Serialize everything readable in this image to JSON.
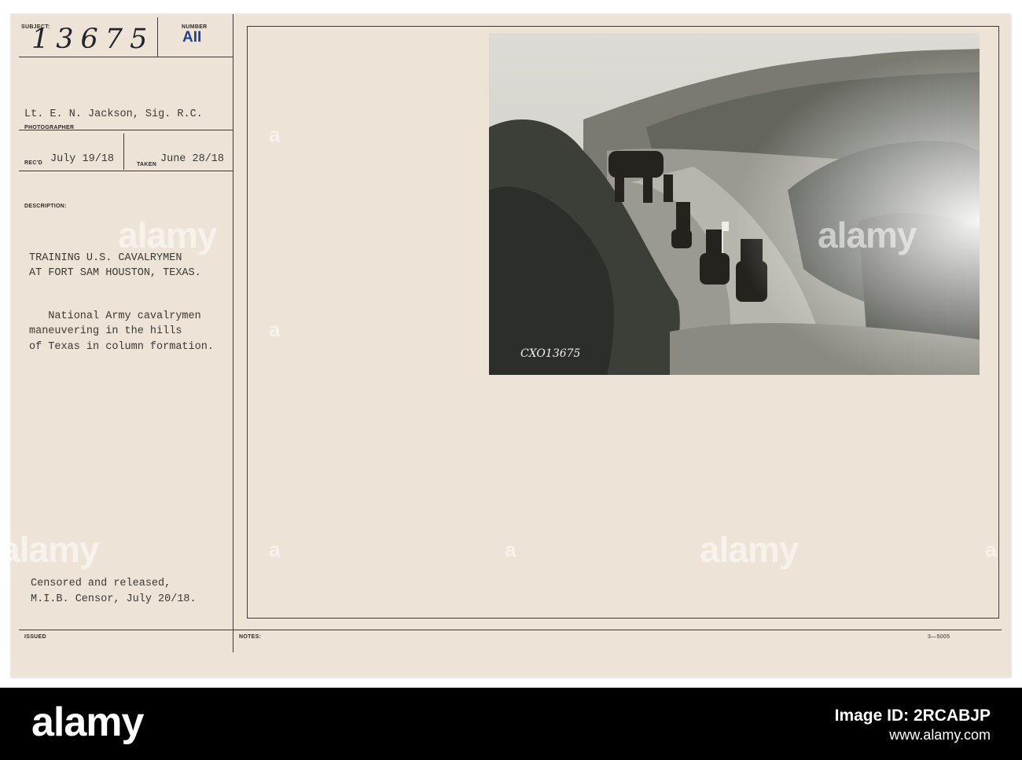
{
  "card": {
    "subject_label": "SUBJECT:",
    "subject_value": "13675",
    "number_label": "NUMBER",
    "number_value": "AII",
    "photographer_value": "Lt. E. N. Jackson, Sig. R.C.",
    "photographer_label": "PHOTOGRAPHER",
    "recd_label": "REC'D",
    "recd_value": "July 19/18",
    "taken_label": "TAKEN",
    "taken_value": "June 28/18",
    "description_label": "DESCRIPTION:",
    "description_title_1": "TRAINING U.S. CAVALRYMEN",
    "description_title_2": "AT FORT SAM HOUSTON, TEXAS.",
    "description_body_1": "   National Army cavalrymen",
    "description_body_2": "maneuvering in the hills",
    "description_body_3": "of Texas in column formation.",
    "censor_line_1": "Censored and released,",
    "censor_line_2": "M.I.B. Censor, July 20/18.",
    "issued_label": "ISSUED",
    "notes_label": "NOTES:",
    "form_number": "3—5005",
    "photo_number": "CXO13675"
  },
  "watermark": {
    "text": "alamy",
    "badge": "a"
  },
  "footer": {
    "logo": "alamy",
    "image_id": "Image ID: 2RCABJP",
    "url": "www.alamy.com"
  }
}
